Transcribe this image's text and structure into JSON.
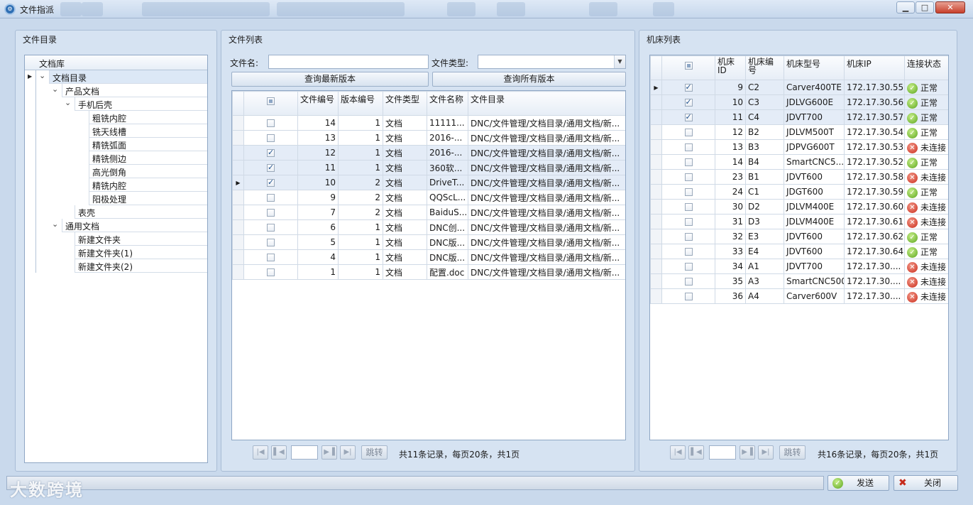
{
  "window": {
    "title": "文件指派"
  },
  "left_panel": {
    "title": "文件目录",
    "tree_header": "文档库",
    "nodes": [
      {
        "label": "文档目录",
        "level": 0,
        "expanded": true,
        "selected": true
      },
      {
        "label": "产品文档",
        "level": 1,
        "expanded": true
      },
      {
        "label": "手机后壳",
        "level": 2,
        "expanded": true
      },
      {
        "label": "粗铣内腔",
        "level": 3
      },
      {
        "label": "铣天线槽",
        "level": 3
      },
      {
        "label": "精铣弧面",
        "level": 3
      },
      {
        "label": "精铣侧边",
        "level": 3
      },
      {
        "label": "高光倒角",
        "level": 3
      },
      {
        "label": "精铣内腔",
        "level": 3
      },
      {
        "label": "阳极处理",
        "level": 3
      },
      {
        "label": "表壳",
        "level": 2
      },
      {
        "label": "通用文档",
        "level": 1,
        "expanded": true
      },
      {
        "label": "新建文件夹",
        "level": 2
      },
      {
        "label": "新建文件夹(1)",
        "level": 2
      },
      {
        "label": "新建文件夹(2)",
        "level": 2
      }
    ]
  },
  "mid_panel": {
    "title": "文件列表",
    "filename_label": "文件名:",
    "filetype_label": "文件类型:",
    "btn_latest": "查询最新版本",
    "btn_all": "查询所有版本",
    "columns": [
      "文件编号",
      "版本编号",
      "文件类型",
      "文件名称",
      "文件目录"
    ],
    "rows": [
      {
        "checked": false,
        "current": false,
        "id": "14",
        "ver": "1",
        "type": "文档",
        "name": "11111...",
        "dir": "DNC/文件管理/文档目录/通用文档/新..."
      },
      {
        "checked": false,
        "current": false,
        "id": "13",
        "ver": "1",
        "type": "文档",
        "name": "2016-...",
        "dir": "DNC/文件管理/文档目录/通用文档/新..."
      },
      {
        "checked": true,
        "current": false,
        "id": "12",
        "ver": "1",
        "type": "文档",
        "name": "2016-...",
        "dir": "DNC/文件管理/文档目录/通用文档/新..."
      },
      {
        "checked": true,
        "current": false,
        "id": "11",
        "ver": "1",
        "type": "文档",
        "name": "360软...",
        "dir": "DNC/文件管理/文档目录/通用文档/新..."
      },
      {
        "checked": true,
        "current": true,
        "id": "10",
        "ver": "2",
        "type": "文档",
        "name": "DriveT...",
        "dir": "DNC/文件管理/文档目录/通用文档/新..."
      },
      {
        "checked": false,
        "current": false,
        "id": "9",
        "ver": "2",
        "type": "文档",
        "name": "QQScL...",
        "dir": "DNC/文件管理/文档目录/通用文档/新..."
      },
      {
        "checked": false,
        "current": false,
        "id": "7",
        "ver": "2",
        "type": "文档",
        "name": "BaiduS...",
        "dir": "DNC/文件管理/文档目录/通用文档/新..."
      },
      {
        "checked": false,
        "current": false,
        "id": "6",
        "ver": "1",
        "type": "文档",
        "name": "DNC创...",
        "dir": "DNC/文件管理/文档目录/通用文档/新..."
      },
      {
        "checked": false,
        "current": false,
        "id": "5",
        "ver": "1",
        "type": "文档",
        "name": "DNC版...",
        "dir": "DNC/文件管理/文档目录/通用文档/新..."
      },
      {
        "checked": false,
        "current": false,
        "id": "4",
        "ver": "1",
        "type": "文档",
        "name": "DNC版...",
        "dir": "DNC/文件管理/文档目录/通用文档/新..."
      },
      {
        "checked": false,
        "current": false,
        "id": "1",
        "ver": "1",
        "type": "文档",
        "name": "配置.doc",
        "dir": "DNC/文件管理/文档目录/通用文档/新..."
      }
    ],
    "pager": {
      "jump": "跳转",
      "summary": "共11条记录，每页20条，共1页"
    }
  },
  "right_panel": {
    "title": "机床列表",
    "columns": [
      "机床ID",
      "机床编号",
      "机床型号",
      "机床IP",
      "连接状态"
    ],
    "rows": [
      {
        "checked": true,
        "current": true,
        "id": "9",
        "code": "C2",
        "model": "Carver400TE",
        "ip": "172.17.30.55",
        "status": "正常",
        "ok": true
      },
      {
        "checked": true,
        "current": false,
        "id": "10",
        "code": "C3",
        "model": "JDLVG600E",
        "ip": "172.17.30.56",
        "status": "正常",
        "ok": true
      },
      {
        "checked": true,
        "current": false,
        "id": "11",
        "code": "C4",
        "model": "JDVT700",
        "ip": "172.17.30.57",
        "status": "正常",
        "ok": true
      },
      {
        "checked": false,
        "current": false,
        "id": "12",
        "code": "B2",
        "model": "JDLVM500T",
        "ip": "172.17.30.54",
        "status": "正常",
        "ok": true
      },
      {
        "checked": false,
        "current": false,
        "id": "13",
        "code": "B3",
        "model": "JDPVG600T",
        "ip": "172.17.30.53",
        "status": "未连接",
        "ok": false
      },
      {
        "checked": false,
        "current": false,
        "id": "14",
        "code": "B4",
        "model": "SmartCNC5...",
        "ip": "172.17.30.52",
        "status": "正常",
        "ok": true
      },
      {
        "checked": false,
        "current": false,
        "id": "23",
        "code": "B1",
        "model": "JDVT600",
        "ip": "172.17.30.58",
        "status": "未连接",
        "ok": false
      },
      {
        "checked": false,
        "current": false,
        "id": "24",
        "code": "C1",
        "model": "JDGT600",
        "ip": "172.17.30.59",
        "status": "正常",
        "ok": true
      },
      {
        "checked": false,
        "current": false,
        "id": "30",
        "code": "D2",
        "model": "JDLVM400E",
        "ip": "172.17.30.60",
        "status": "未连接",
        "ok": false
      },
      {
        "checked": false,
        "current": false,
        "id": "31",
        "code": "D3",
        "model": "JDLVM400E",
        "ip": "172.17.30.61",
        "status": "未连接",
        "ok": false
      },
      {
        "checked": false,
        "current": false,
        "id": "32",
        "code": "E3",
        "model": "JDVT600",
        "ip": "172.17.30.62",
        "status": "正常",
        "ok": true
      },
      {
        "checked": false,
        "current": false,
        "id": "33",
        "code": "E4",
        "model": "JDVT600",
        "ip": "172.17.30.64",
        "status": "正常",
        "ok": true
      },
      {
        "checked": false,
        "current": false,
        "id": "34",
        "code": "A1",
        "model": "JDVT700",
        "ip": "172.17.30....",
        "status": "未连接",
        "ok": false
      },
      {
        "checked": false,
        "current": false,
        "id": "35",
        "code": "A3",
        "model": "SmartCNC500",
        "ip": "172.17.30....",
        "status": "未连接",
        "ok": false
      },
      {
        "checked": false,
        "current": false,
        "id": "36",
        "code": "A4",
        "model": "Carver600V",
        "ip": "172.17.30....",
        "status": "未连接",
        "ok": false
      }
    ],
    "pager": {
      "jump": "跳转",
      "summary": "共16条记录，每页20条，共1页"
    }
  },
  "bottom": {
    "watermark": "大数跨境",
    "send": "发送",
    "close": "关闭"
  },
  "icons": {
    "ok": "check-circle-icon",
    "error": "x-circle-icon"
  }
}
